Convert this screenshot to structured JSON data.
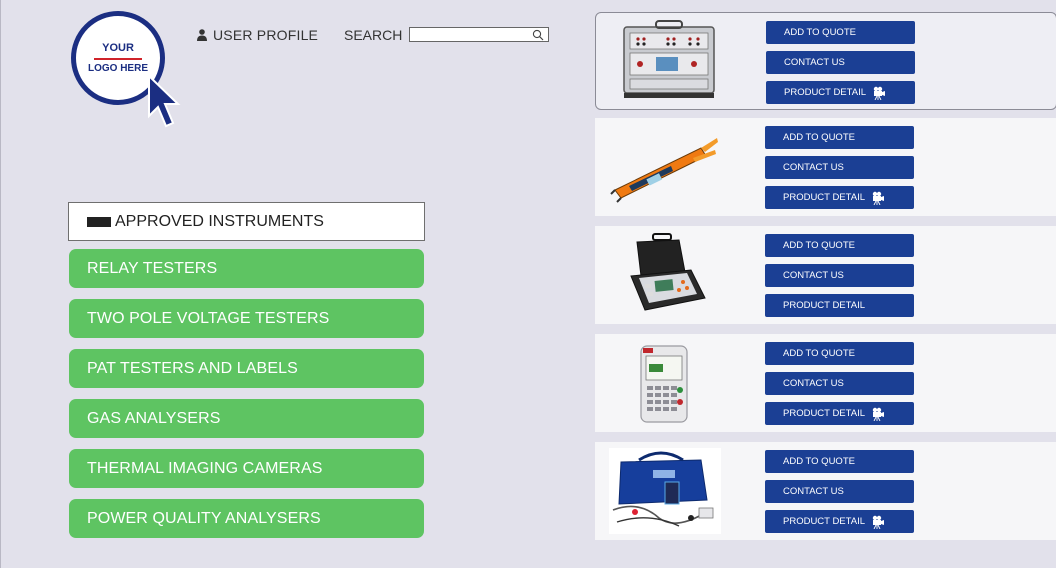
{
  "logo": {
    "line1": "YOUR",
    "line2": "LOGO HERE"
  },
  "header": {
    "user_profile": "USER PROFILE",
    "search_label": "SEARCH",
    "search_value": ""
  },
  "menu": {
    "approved": "APPROVED INSTRUMENTS",
    "categories": [
      "RELAY TESTERS",
      "TWO POLE VOLTAGE TESTERS",
      "PAT TESTERS AND LABELS",
      "GAS ANALYSERS",
      "THERMAL IMAGING CAMERAS",
      "POWER QUALITY ANALYSERS"
    ]
  },
  "products": [
    {
      "image": "relay-tester-image",
      "quote": "ADD TO QUOTE",
      "contact": "CONTACT US",
      "detail": "PRODUCT DETAIL",
      "video": true
    },
    {
      "image": "voltage-tester-image",
      "quote": "ADD TO QUOTE",
      "contact": "CONTACT US",
      "detail": "PRODUCT DETAIL",
      "video": true
    },
    {
      "image": "pat-tester-case-image",
      "quote": "ADD TO QUOTE",
      "contact": "CONTACT US",
      "detail": "PRODUCT DETAIL",
      "video": false
    },
    {
      "image": "handheld-tester-image",
      "quote": "ADD TO QUOTE",
      "contact": "CONTACT US",
      "detail": "PRODUCT DETAIL",
      "video": true
    },
    {
      "image": "test-kit-bag-image",
      "quote": "ADD TO QUOTE",
      "contact": "CONTACT US",
      "detail": "PRODUCT DETAIL",
      "video": true
    }
  ],
  "colors": {
    "background": "#e2e1eb",
    "brand_navy": "#1b2e82",
    "button_blue": "#1b3f94",
    "category_green": "#5ec462",
    "logo_red": "#d0232a"
  }
}
